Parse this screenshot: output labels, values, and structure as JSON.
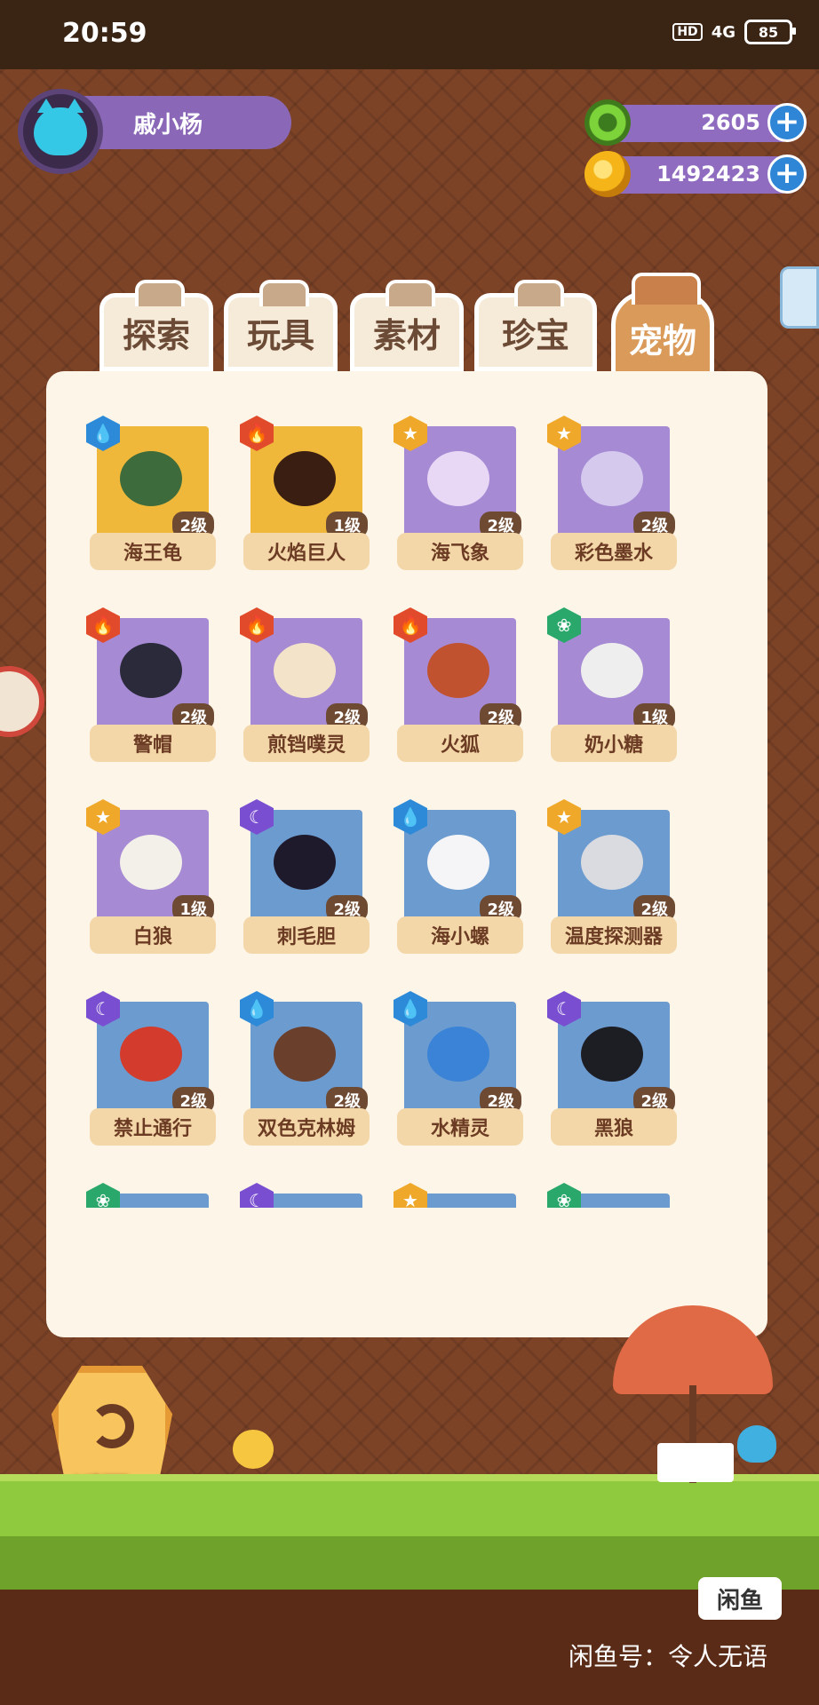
{
  "status_bar": {
    "time": "20:59",
    "network": "4G",
    "hd": "HD",
    "battery": "85"
  },
  "player": {
    "name": "戚小杨"
  },
  "currencies": [
    {
      "name": "gem",
      "value": "2605"
    },
    {
      "name": "coin",
      "value": "1492423"
    }
  ],
  "tabs": [
    {
      "label": "探索",
      "active": false
    },
    {
      "label": "玩具",
      "active": false
    },
    {
      "label": "素材",
      "active": false
    },
    {
      "label": "珍宝",
      "active": false
    },
    {
      "label": "宠物",
      "active": true
    }
  ],
  "pets": [
    {
      "name": "海王龟",
      "level": "2级",
      "element": "water",
      "bg": "gold"
    },
    {
      "name": "火焰巨人",
      "level": "1级",
      "element": "fire",
      "bg": "gold"
    },
    {
      "name": "海飞象",
      "level": "2级",
      "element": "star",
      "bg": "purple"
    },
    {
      "name": "彩色墨水",
      "level": "2级",
      "element": "star",
      "bg": "purple"
    },
    {
      "name": "警帽",
      "level": "2级",
      "element": "fire",
      "bg": "purple"
    },
    {
      "name": "煎铛噗灵",
      "level": "2级",
      "element": "fire",
      "bg": "purple"
    },
    {
      "name": "火狐",
      "level": "2级",
      "element": "fire",
      "bg": "purple"
    },
    {
      "name": "奶小糖",
      "level": "1级",
      "element": "leaf",
      "bg": "purple"
    },
    {
      "name": "白狼",
      "level": "1级",
      "element": "star",
      "bg": "purple"
    },
    {
      "name": "刺毛胆",
      "level": "2级",
      "element": "moon",
      "bg": "blue"
    },
    {
      "name": "海小螺",
      "level": "2级",
      "element": "water",
      "bg": "blue"
    },
    {
      "name": "温度探测器",
      "level": "2级",
      "element": "star",
      "bg": "blue"
    },
    {
      "name": "禁止通行",
      "level": "2级",
      "element": "moon",
      "bg": "blue"
    },
    {
      "name": "双色克林姆",
      "level": "2级",
      "element": "water",
      "bg": "blue"
    },
    {
      "name": "水精灵",
      "level": "2级",
      "element": "water",
      "bg": "blue"
    },
    {
      "name": "黑狼",
      "level": "2级",
      "element": "moon",
      "bg": "blue"
    },
    {
      "name": "",
      "level": "",
      "element": "leaf",
      "bg": "blue"
    },
    {
      "name": "",
      "level": "",
      "element": "moon",
      "bg": "blue"
    },
    {
      "name": "",
      "level": "",
      "element": "star",
      "bg": "blue"
    },
    {
      "name": "",
      "level": "",
      "element": "leaf",
      "bg": "blue"
    }
  ],
  "return_button": {
    "label": "返回"
  },
  "watermark": {
    "logo": "闲鱼",
    "text": "闲鱼号：令人无语"
  }
}
